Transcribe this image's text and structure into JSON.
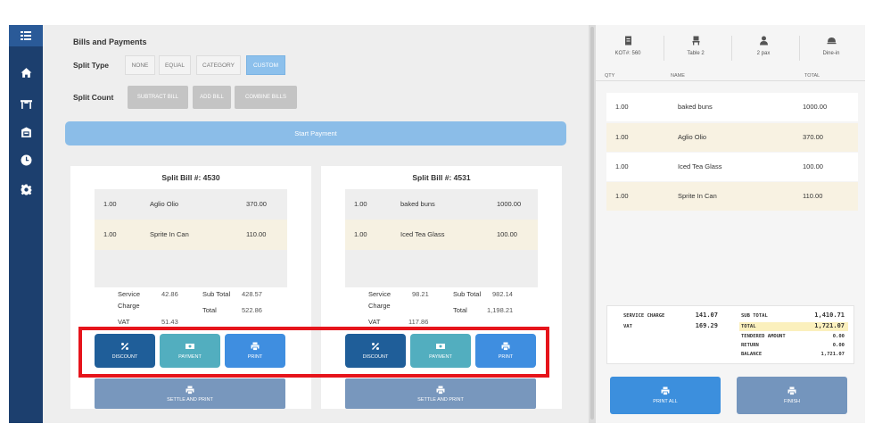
{
  "sidebar": {
    "icons": [
      "grid-icon",
      "home-icon",
      "table-icon",
      "dashboard-icon",
      "clock-icon",
      "gear-icon"
    ]
  },
  "bills": {
    "title": "Bills and Payments",
    "split_type_label": "Split Type",
    "split_types": [
      "NONE",
      "EQUAL",
      "CATEGORY",
      "CUSTOM"
    ],
    "split_type_selected": "CUSTOM",
    "split_count_label": "Split Count",
    "split_counts": [
      "SUBTRACT BILL",
      "ADD BILL",
      "COMBINE BILLS"
    ],
    "start_payment": "Start Payment"
  },
  "split_bills": [
    {
      "title": "Split Bill #: 4530",
      "items": [
        {
          "qty": "1.00",
          "name": "Aglio Olio",
          "total": "370.00"
        },
        {
          "qty": "1.00",
          "name": "Sprite In Can",
          "total": "110.00"
        }
      ],
      "service_label": "Service",
      "charge_label": "Charge",
      "service_charge": "42.86",
      "subtotal_label": "Sub Total",
      "subtotal": "428.57",
      "total_label": "Total",
      "total": "522.86",
      "vat_label": "VAT",
      "vat": "51.43",
      "discount": "DISCOUNT",
      "payment": "PAYMENT",
      "print": "PRINT",
      "settle": "SETTLE AND PRINT"
    },
    {
      "title": "Split Bill #: 4531",
      "items": [
        {
          "qty": "1.00",
          "name": "baked buns",
          "total": "1000.00"
        },
        {
          "qty": "1.00",
          "name": "Iced Tea Glass",
          "total": "100.00"
        }
      ],
      "service_label": "Service",
      "charge_label": "Charge",
      "service_charge": "98.21",
      "subtotal_label": "Sub Total",
      "subtotal": "982.14",
      "total_label": "Total",
      "total": "1,198.21",
      "vat_label": "VAT",
      "vat": "117.86",
      "discount": "DISCOUNT",
      "payment": "PAYMENT",
      "print": "PRINT",
      "settle": "SETTLE AND PRINT"
    }
  ],
  "order": {
    "kot": "KOT#: 560",
    "table": "Table 2",
    "pax": "2 pax",
    "mode": "Dine-in",
    "col_qty": "QTY",
    "col_name": "NAME",
    "col_total": "TOTAL",
    "items": [
      {
        "qty": "1.00",
        "name": "baked buns",
        "total": "1000.00"
      },
      {
        "qty": "1.00",
        "name": "Aglio Olio",
        "total": "370.00"
      },
      {
        "qty": "1.00",
        "name": "Iced Tea Glass",
        "total": "100.00"
      },
      {
        "qty": "1.00",
        "name": "Sprite In Can",
        "total": "110.00"
      }
    ]
  },
  "totals": {
    "service_charge_label": "SERVICE CHARGE",
    "service_charge": "141.07",
    "vat_label": "VAT",
    "vat": "169.29",
    "sub_total_label": "SUB TOTAL",
    "sub_total": "1,410.71",
    "total_label": "TOTAL",
    "total": "1,721.07",
    "tendered_label": "TENDERED AMOUNT",
    "tendered": "0.00",
    "return_label": "RETURN",
    "return": "0.00",
    "balance_label": "BALANCE",
    "balance": "1,721.07"
  },
  "actions": {
    "print_all": "PRINT ALL",
    "finish": "FINISH"
  },
  "colors": {
    "sidebar": "#1c3f6e",
    "highlight": "#e6141b",
    "discount": "#1f5e99",
    "payment": "#52aebf",
    "print": "#3f8ee0"
  }
}
